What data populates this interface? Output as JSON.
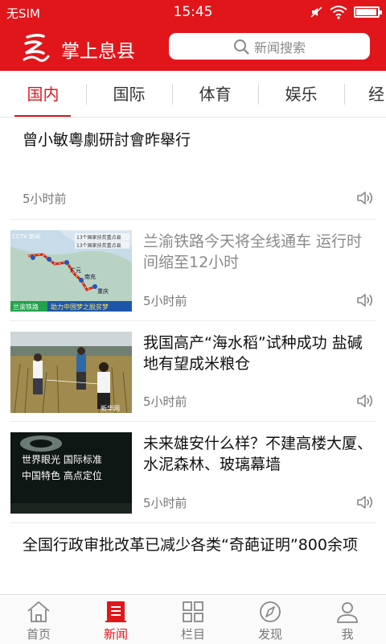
{
  "status_bar": {
    "carrier": "无SIM",
    "time": "15:45",
    "battery_level": 0.95
  },
  "header": {
    "app_name": "掌上息县",
    "search_placeholder": "新闻搜索"
  },
  "tabs": [
    {
      "label": "国内",
      "active": true
    },
    {
      "label": "国际",
      "active": false
    },
    {
      "label": "体育",
      "active": false
    },
    {
      "label": "娱乐",
      "active": false
    },
    {
      "label": "经",
      "active": false
    }
  ],
  "news": [
    {
      "title": "曾小敏粵劇研討會昨舉行",
      "time": "5小时前",
      "read": false,
      "thumbnail": null
    },
    {
      "title": "兰渝铁路今天将全线通车 运行时间缩至12小时",
      "time": "5小时前",
      "read": true,
      "thumbnail": {
        "channel_logo": "CCTV 新闻",
        "map_legend_1": "13个国家扶贫重点县",
        "map_legend_2": "13个国家扶贫重点县",
        "map_places": [
          "广元",
          "南充",
          "重庆"
        ],
        "caption_left": "兰渝铁路",
        "caption_right": "助力中国梦之脱贫梦"
      }
    },
    {
      "title": "我国高产“海水稻”试种成功 盐碱地有望成米粮仓",
      "time": "5小时前",
      "read": false,
      "thumbnail": {
        "watermark": "新华网"
      }
    },
    {
      "title": "未来雄安什么样？不建高楼大厦、水泥森林、玻璃幕墙",
      "time": "5小时前",
      "read": false,
      "thumbnail": {
        "line_1": "世界眼光 国际标准",
        "line_2": "中国特色 高点定位"
      }
    },
    {
      "title": "全国行政审批改革已减少各类“奇葩证明”800余项",
      "time": "",
      "read": false,
      "thumbnail": null
    }
  ],
  "bottom_nav": [
    {
      "label": "首页",
      "icon": "home-icon",
      "active": false
    },
    {
      "label": "新闻",
      "icon": "news-icon",
      "active": true
    },
    {
      "label": "栏目",
      "icon": "grid-icon",
      "active": false
    },
    {
      "label": "发现",
      "icon": "compass-icon",
      "active": false
    },
    {
      "label": "我",
      "icon": "person-icon",
      "active": false
    }
  ],
  "colors": {
    "brand_red": "#e0161b",
    "read_title": "#8a8a8a",
    "inactive_nav": "#777777"
  }
}
